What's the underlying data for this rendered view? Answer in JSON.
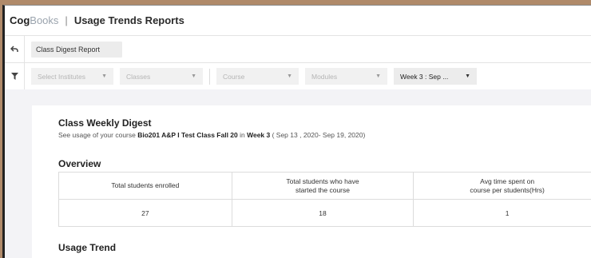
{
  "header": {
    "logo_bold": "Cog",
    "logo_light": "Books",
    "separator": "|",
    "title": "Usage Trends Reports"
  },
  "breadcrumb": {
    "back_icon": "back-arrow-icon",
    "label": "Class Digest Report"
  },
  "filters": {
    "filter_icon": "funnel-icon",
    "institutes": "Select Institutes",
    "classes": "Classes",
    "course": "Course",
    "modules": "Modules",
    "week": "Week 3 : Sep ..."
  },
  "digest": {
    "title": "Class Weekly Digest",
    "sub_prefix": "See usage of your course ",
    "course_name": "Bio201 A&P I Test Class Fall 20",
    "sub_in": " in ",
    "week": "Week 3",
    "date_range": " ( Sep 13 , 2020- Sep 19, 2020)"
  },
  "overview": {
    "title": "Overview",
    "headers": [
      [
        "Total students enrolled"
      ],
      [
        "Total students who have",
        "started the course"
      ],
      [
        "Avg time spent on",
        "course per students(Hrs)"
      ]
    ],
    "values": [
      "27",
      "18",
      "1"
    ]
  },
  "usage_trend": {
    "title": "Usage Trend"
  }
}
